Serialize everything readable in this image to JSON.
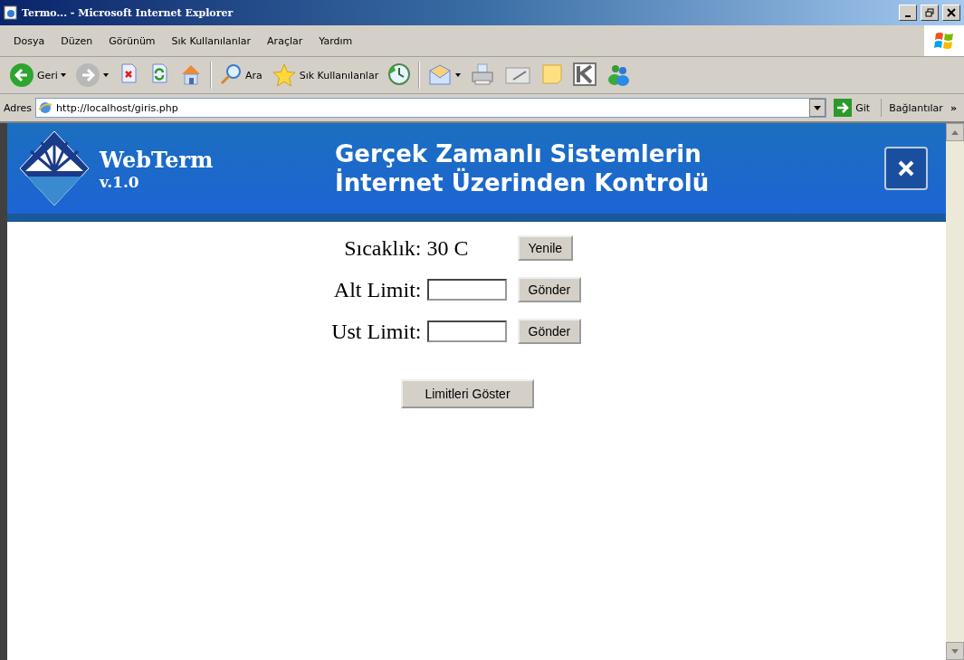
{
  "window": {
    "title": "Termo... - Microsoft Internet Explorer"
  },
  "menu": [
    "Dosya",
    "Düzen",
    "Görünüm",
    "Sık Kullanılanlar",
    "Araçlar",
    "Yardım"
  ],
  "toolbar": [
    {
      "kind": "back",
      "label": "Geri",
      "dropdown": true
    },
    {
      "kind": "forward",
      "dropdown": true
    },
    {
      "kind": "stop"
    },
    {
      "kind": "refresh"
    },
    {
      "kind": "home"
    },
    {
      "kind": "separator"
    },
    {
      "kind": "search",
      "label": "Ara"
    },
    {
      "kind": "favorites",
      "label": "Sık Kullanılanlar"
    },
    {
      "kind": "history"
    },
    {
      "kind": "separator"
    },
    {
      "kind": "mail",
      "dropdown": true
    },
    {
      "kind": "print"
    },
    {
      "kind": "edit"
    },
    {
      "kind": "note"
    },
    {
      "kind": "k"
    },
    {
      "kind": "messenger"
    }
  ],
  "address_bar": {
    "label": "Adres",
    "value": "http://localhost/giris.php",
    "go": "Git",
    "links": "Bağlantılar",
    "more": "»"
  },
  "banner": {
    "name": "WebTerm",
    "version": "v.1.0",
    "title_lines": [
      "Gerçek Zamanlı Sistemlerin",
      "İnternet Üzerinden Kontrolü"
    ]
  },
  "form": {
    "rows": [
      {
        "kind": "reading",
        "label": "Sıcaklık:",
        "value": "30 C",
        "button": "Yenile"
      },
      {
        "kind": "input",
        "label": "Alt Limit:",
        "button": "Gönder"
      },
      {
        "kind": "input",
        "label": "Ust Limit:",
        "button": "Gönder"
      }
    ],
    "show_button": "Limitleri Göster"
  }
}
